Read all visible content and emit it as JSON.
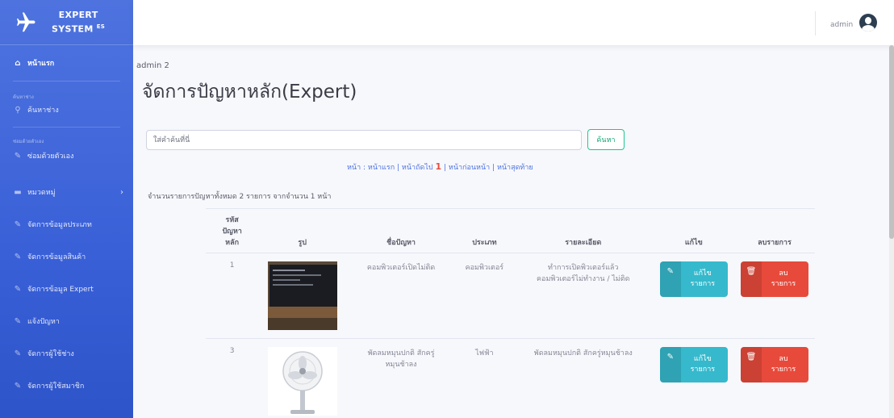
{
  "brand": {
    "line1": "EXPERT",
    "line2": "SYSTEM",
    "sup": "ES"
  },
  "sidebar": {
    "home": "หน้าแรก",
    "section_search": "ค้นหาช่าง",
    "search_tech": "ค้นหาช่าง",
    "section_self": "ซ่อมด้วยตัวเอง",
    "self_repair": "ซ่อมด้วยตัวเอง",
    "category": "หมวดหมู่",
    "manage_type": "จัดการข้อมูลประเภท",
    "manage_product": "จัดการข้อมูลสินค้า",
    "manage_expert": "จัดการข้อมูล Expert",
    "report_problem": "แจ้งปัญหา",
    "manage_tech": "จัดการผู้ใช้ช่าง",
    "manage_member": "จัดการผู้ใช้สมาชิก"
  },
  "topbar": {
    "username": "admin"
  },
  "breadcrumb": "admin 2",
  "title": "จัดการปัญหาหลัก(Expert)",
  "search": {
    "placeholder": "ใส่คำค้นที่นี่",
    "button": "ค้นหา"
  },
  "pager": {
    "label": "หน้า :",
    "first": "หน้าแรก",
    "next": "หน้าถัดไป",
    "current": "1",
    "prev": "หน้าก่อนหน้า",
    "last": "หน้าสุดท้าย"
  },
  "summary": "จำนวนรายการปัญหาทั้งหมด 2 รายการ จากจำนวน 1 หน้า",
  "table": {
    "headers": {
      "id_line1": "รหัส",
      "id_line2": "ปัญหา",
      "id_line3": "หลัก",
      "image": "รูป",
      "name": "ชื่อปัญหา",
      "type": "ประเภท",
      "detail": "รายละเอียด",
      "edit": "แก้ไข",
      "delete": "ลบรายการ"
    },
    "rows": [
      {
        "id": "1",
        "name": "คอมพิวเตอร์เปิดไม่ติด",
        "type": "คอมพิวเตอร์",
        "detail_line1": "ทำการเปิดพิวเตอร์แล้ว",
        "detail_line2": "คอมพิวเตอร์ไม่ทำงาน / ไม่ติด"
      },
      {
        "id": "3",
        "name_line1": "พัดลมหมุนปกติ สักครู่",
        "name_line2": "หมุนช้าลง",
        "type": "ไฟฟ้า",
        "detail": "พัดลมหมุนปกติ สักครู่หมุนช้าลง"
      }
    ],
    "edit_line1": "แก้ไข",
    "edit_line2": "รายการ",
    "delete_line1": "ลบ",
    "delete_line2": "รายการ"
  }
}
